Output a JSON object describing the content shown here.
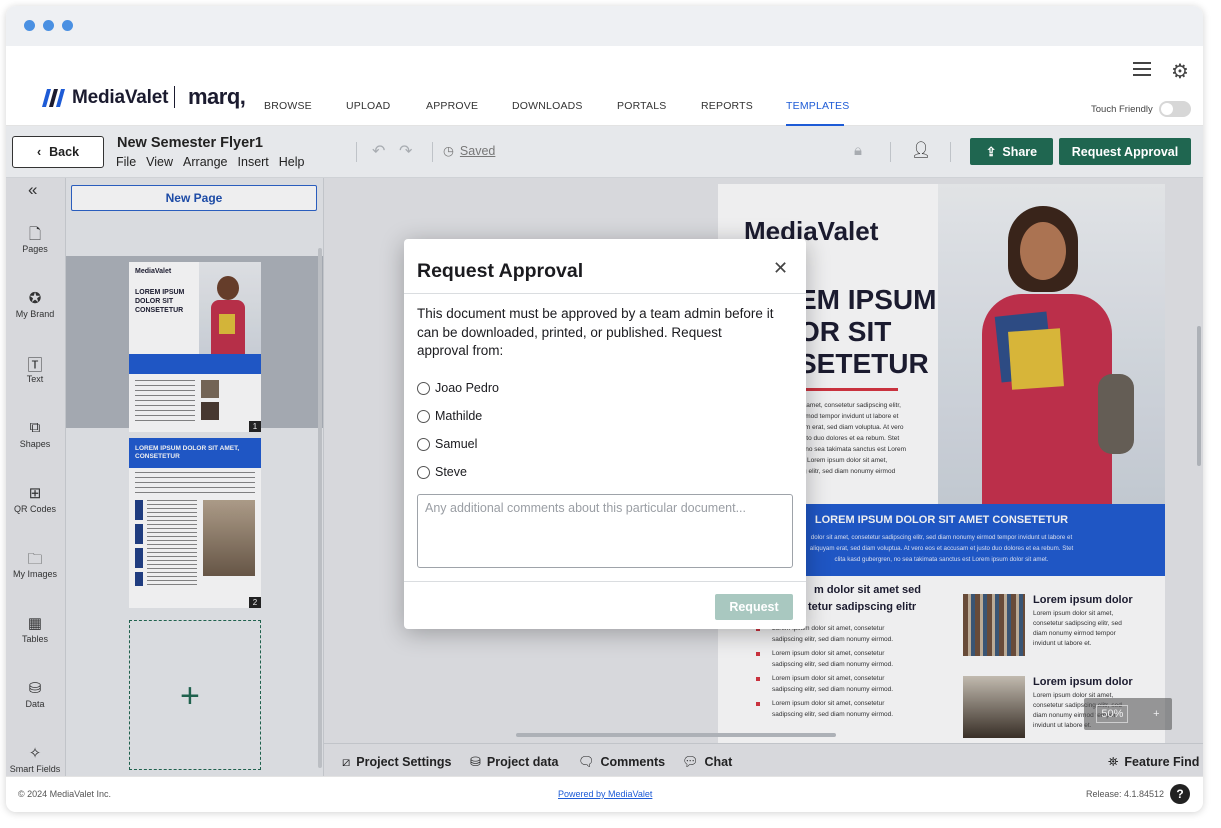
{
  "header": {
    "brand": "MediaValet",
    "partner": "marq",
    "nav": [
      "BROWSE",
      "UPLOAD",
      "APPROVE",
      "DOWNLOADS",
      "PORTALS",
      "REPORTS",
      "TEMPLATES"
    ],
    "active_nav": "TEMPLATES",
    "touch_friendly_label": "Touch Friendly",
    "touch_friendly_on": false
  },
  "toolbar": {
    "back_label": "Back",
    "doc_title": "New Semester Flyer1",
    "menu": [
      "File",
      "View",
      "Arrange",
      "Insert",
      "Help"
    ],
    "saved_label": "Saved",
    "share_label": "Share",
    "request_approval_label": "Request Approval"
  },
  "sidebar": {
    "items": [
      {
        "label": "Pages",
        "icon": "page-icon"
      },
      {
        "label": "My Brand",
        "icon": "brand-icon"
      },
      {
        "label": "Text",
        "icon": "text-icon"
      },
      {
        "label": "Shapes",
        "icon": "shapes-icon"
      },
      {
        "label": "QR Codes",
        "icon": "qr-icon"
      },
      {
        "label": "My Images",
        "icon": "folder-icon"
      },
      {
        "label": "Tables",
        "icon": "table-icon"
      },
      {
        "label": "Data",
        "icon": "database-icon"
      },
      {
        "label": "Smart Fields",
        "icon": "smart-fields-icon"
      }
    ]
  },
  "pages_panel": {
    "new_page_label": "New Page",
    "pages": [
      {
        "number": "1",
        "brand": "MediaValet",
        "headline": "LOREM IPSUM DOLOR SIT CONSETETUR"
      },
      {
        "number": "2",
        "headline": "LOREM IPSUM DOLOR SIT AMET, CONSETETUR"
      }
    ],
    "add_page_symbol": "+"
  },
  "flyer": {
    "logo": "MediaValet",
    "headline_line1": "EM IPSUM",
    "headline_line2": "OR SIT",
    "headline_line3": "SETETUR",
    "body_lines": [
      "sit amet, consetetur sadipscing elitr,",
      "eirmod tempor invidunt ut labore et",
      "yam erat, sed diam voluptua. At vero",
      "justo duo dolores et ea rebum. Stet",
      "n, no sea takimata sanctus est Lorem",
      "et. Lorem ipsum dolor sit amet,",
      "ing elitr, sed diam nonumy eirmod"
    ],
    "band_title": "LOREM IPSUM DOLOR SIT AMET CONSETETUR",
    "band_lines": [
      "dolor sit amet, consetetur sadipscing elitr, sed diam nonumy eirmod tempor invidunt ut labore et",
      "aliquyam erat, sed diam voluptua. At vero eos et accusam et justo duo dolores et ea rebum. Stet",
      "clita kasd gubergren, no sea takimata sanctus est Lorem ipsum dolor sit amet."
    ],
    "col_title": "m dolor sit amet sed",
    "col_title2": "tetur sadipscing elitr",
    "bullets": [
      "Lorem ipsum dolor sit amet, consetetur",
      "sadipscing elitr, sed diam nonumy eirmod.",
      "Lorem ipsum dolor sit amet, consetetur",
      "sadipscing elitr, sed diam nonumy eirmod.",
      "Lorem ipsum dolor sit amet, consetetur",
      "sadipscing elitr, sed diam nonumy eirmod.",
      "Lorem ipsum dolor sit amet, consetetur",
      "sadipscing elitr, sed diam nonumy eirmod."
    ],
    "right_title_1": "Lorem ipsum dolor",
    "right_text_1": [
      "Lorem ipsum dolor sit amet,",
      "consetetur sadipscing elitr, sed",
      "diam nonumy eirmod tempor",
      "invidunt ut labore et."
    ],
    "right_title_2": "Lorem ipsum dolor",
    "right_text_2": [
      "Lorem ipsum dolor sit amet,",
      "consetetur sadipscing elitr, sed",
      "diam nonumy eirmod tempor",
      "invidunt ut labore et."
    ],
    "zoom": "50%"
  },
  "bottombar": {
    "project_settings": "Project Settings",
    "project_data": "Project data",
    "comments": "Comments",
    "chat": "Chat",
    "feature_find": "Feature Find"
  },
  "footer": {
    "copyright": "© 2024 MediaValet Inc.",
    "powered": "Powered by MediaValet",
    "release": "Release: 4.1.84512",
    "help": "?"
  },
  "modal": {
    "title": "Request Approval",
    "text": "This document must be approved by a team admin before it can be downloaded, printed, or published. Request approval from:",
    "approvers": [
      "Joao Pedro",
      "Mathilde",
      "Samuel",
      "Steve"
    ],
    "comment_placeholder": "Any additional comments about this particular document...",
    "request_label": "Request"
  },
  "colors": {
    "brand_blue": "#1d5bd6",
    "action_green": "#1f6650",
    "disabled_green": "#a9c8c0",
    "flyer_band": "#1f5bd1",
    "accent_red": "#d7333f"
  }
}
